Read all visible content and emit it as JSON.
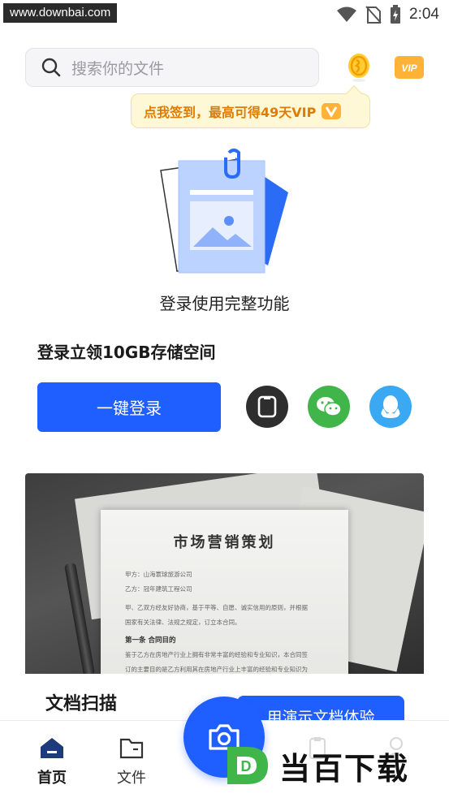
{
  "status_bar": {
    "watermark": "www.downbai.com",
    "time": "2:04"
  },
  "search": {
    "placeholder": "搜索你的文件"
  },
  "checkin_tip": {
    "text": "点我签到，最高可得49天VIP"
  },
  "vip_badge": "VIP",
  "login": {
    "title": "登录使用完整功能",
    "storage": "登录立领10GB存储空间",
    "one_click_label": "一键登录"
  },
  "feature_card": {
    "title": "文档扫描",
    "demo_button": "用演示文档体验",
    "doc": {
      "title": "市场营销策划",
      "line1": "甲方：山海寰球旅游公司",
      "line2": "乙方：冠年建筑工程公司",
      "line3": "甲、乙双方经友好协商，基于平等、自愿、诚实信用的原则，并根据",
      "line4": "国家有关法律、法规之规定，订立本合同。",
      "section": "第一条  合同目的",
      "line5": "鉴于乙方在房地产行业上拥有非常丰富的经验和专业知识，本合同签",
      "line6": "订的主要目的是乙方利用其在房地产行业上丰富的经验和专业知识为"
    }
  },
  "bottom_nav": {
    "home": "首页",
    "files": "文件"
  },
  "brand": {
    "text": "当百下载",
    "letter": "D"
  },
  "colors": {
    "accent": "#1f5eff",
    "tip_text": "#e07b00",
    "wechat": "#3fb54a",
    "qq": "#3aa8f2"
  }
}
